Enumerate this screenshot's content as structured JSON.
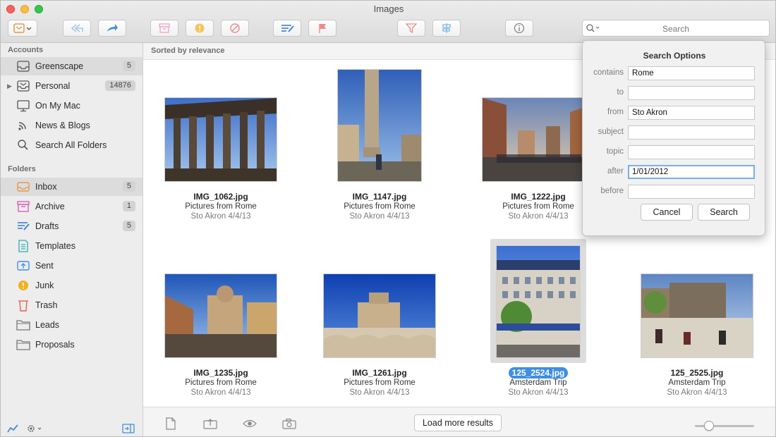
{
  "window": {
    "title": "Images"
  },
  "toolbar": {
    "search_placeholder": "Search"
  },
  "sidebar": {
    "accounts_title": "Accounts",
    "accounts": [
      {
        "label": "Greenscape",
        "badge": "5",
        "icon": "inbox-tray-icon"
      },
      {
        "label": "Personal",
        "badge": "14876",
        "icon": "inbox-tray-icon"
      },
      {
        "label": "On My Mac",
        "badge": "",
        "icon": "monitor-icon"
      },
      {
        "label": "News & Blogs",
        "badge": "",
        "icon": "rss-icon"
      },
      {
        "label": "Search All Folders",
        "badge": "",
        "icon": "search-icon"
      }
    ],
    "folders_title": "Folders",
    "folders": [
      {
        "label": "Inbox",
        "badge": "5",
        "icon": "inbox-icon",
        "color": "#e9954a"
      },
      {
        "label": "Archive",
        "badge": "1",
        "icon": "archive-icon",
        "color": "#d957b3"
      },
      {
        "label": "Drafts",
        "badge": "5",
        "icon": "drafts-icon",
        "color": "#3d7fd6"
      },
      {
        "label": "Templates",
        "badge": "",
        "icon": "templates-icon",
        "color": "#2fb0a8"
      },
      {
        "label": "Sent",
        "badge": "",
        "icon": "sent-icon",
        "color": "#3d8ee6"
      },
      {
        "label": "Junk",
        "badge": "",
        "icon": "junk-icon",
        "color": "#f2b01e"
      },
      {
        "label": "Trash",
        "badge": "",
        "icon": "trash-icon",
        "color": "#e8614f"
      },
      {
        "label": "Leads",
        "badge": "",
        "icon": "folder-icon",
        "color": "#777777"
      },
      {
        "label": "Proposals",
        "badge": "",
        "icon": "folder-icon",
        "color": "#777777"
      }
    ]
  },
  "main": {
    "sort_label": "Sorted by relevance",
    "tiles": [
      {
        "file": "IMG_1062.jpg",
        "desc": "Pictures from Rome",
        "meta": "Sto Akron   4/4/13",
        "selected": false
      },
      {
        "file": "IMG_1147.jpg",
        "desc": "Pictures from Rome",
        "meta": "Sto Akron   4/4/13",
        "selected": false
      },
      {
        "file": "IMG_1222.jpg",
        "desc": "Pictures from Rome",
        "meta": "Sto Akron   4/4/13",
        "selected": false
      },
      {
        "file": "IMG_1235.jpg",
        "desc": "Pictures from Rome",
        "meta": "Sto Akron   4/4/13",
        "selected": false
      },
      {
        "file": "IMG_1261.jpg",
        "desc": "Pictures from Rome",
        "meta": "Sto Akron   4/4/13",
        "selected": false
      },
      {
        "file": "125_2524.jpg",
        "desc": "Amsterdam Trip",
        "meta": "Sto Akron   4/4/13",
        "selected": true
      },
      {
        "file": "125_2525.jpg",
        "desc": "Amsterdam Trip",
        "meta": "Sto Akron   4/4/13",
        "selected": false
      }
    ],
    "load_more": "Load more results"
  },
  "search_options": {
    "title": "Search Options",
    "fields": [
      {
        "label": "contains",
        "value": "Rome"
      },
      {
        "label": "to",
        "value": ""
      },
      {
        "label": "from",
        "value": "Sto Akron"
      },
      {
        "label": "subject",
        "value": ""
      },
      {
        "label": "topic",
        "value": ""
      },
      {
        "label": "after",
        "value": "1/01/2012"
      },
      {
        "label": "before",
        "value": ""
      }
    ],
    "cancel": "Cancel",
    "search": "Search"
  },
  "colors": {
    "accent": "#3d8ee6",
    "toolbar_icon": "#f08a8a"
  }
}
